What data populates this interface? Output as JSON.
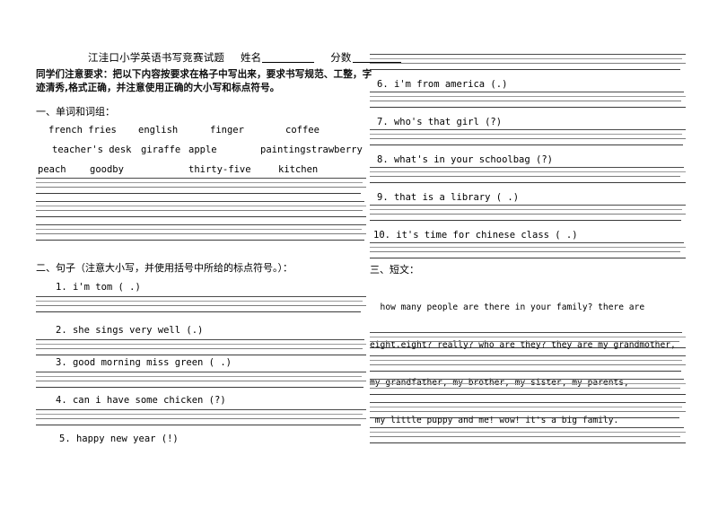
{
  "document": {
    "header": {
      "title": "江洼口小学英语书写竞赛试题",
      "name_label": "姓名",
      "score_label": "分数"
    },
    "notice": "同学们注意要求：把以下内容按要求在格子中写出来，要求书写规范、工整，字迹清秀,格式正确，并注意使用正确的大小写和标点符号。",
    "sections": {
      "one": "一、单词和词组：",
      "two": "二、句子（注意大小写，并使用括号中所给的标点符号。）：",
      "three": "三、短文："
    },
    "words": {
      "row1": [
        "french fries",
        "english",
        "finger",
        "coffee"
      ],
      "row2": [
        "teacher's desk",
        "giraffe",
        "apple",
        "paintingstrawberry"
      ],
      "row3": [
        "peach",
        "goodby",
        "thirty-five",
        "kitchen"
      ]
    },
    "sentences": [
      "1. i'm tom ( .)",
      "2. she sings very well  (.)",
      "3. good morning miss green ( .)",
      "4. can i have some chicken (?)",
      "5. happy new year (!)",
      "6. i'm from america (.)",
      "7. who's that girl (?)",
      "8. what's in your schoolbag (?)",
      "9. that is a library ( .)",
      "10. it's time for chinese class ( .)"
    ],
    "passage": [
      "  how many people are there in your family? there are",
      "eight.eight? really? who are they? they are my grandmother,",
      "my grandfather, my brother, my sister, my parents,",
      " my little puppy and me! wow! it's a big family."
    ]
  }
}
